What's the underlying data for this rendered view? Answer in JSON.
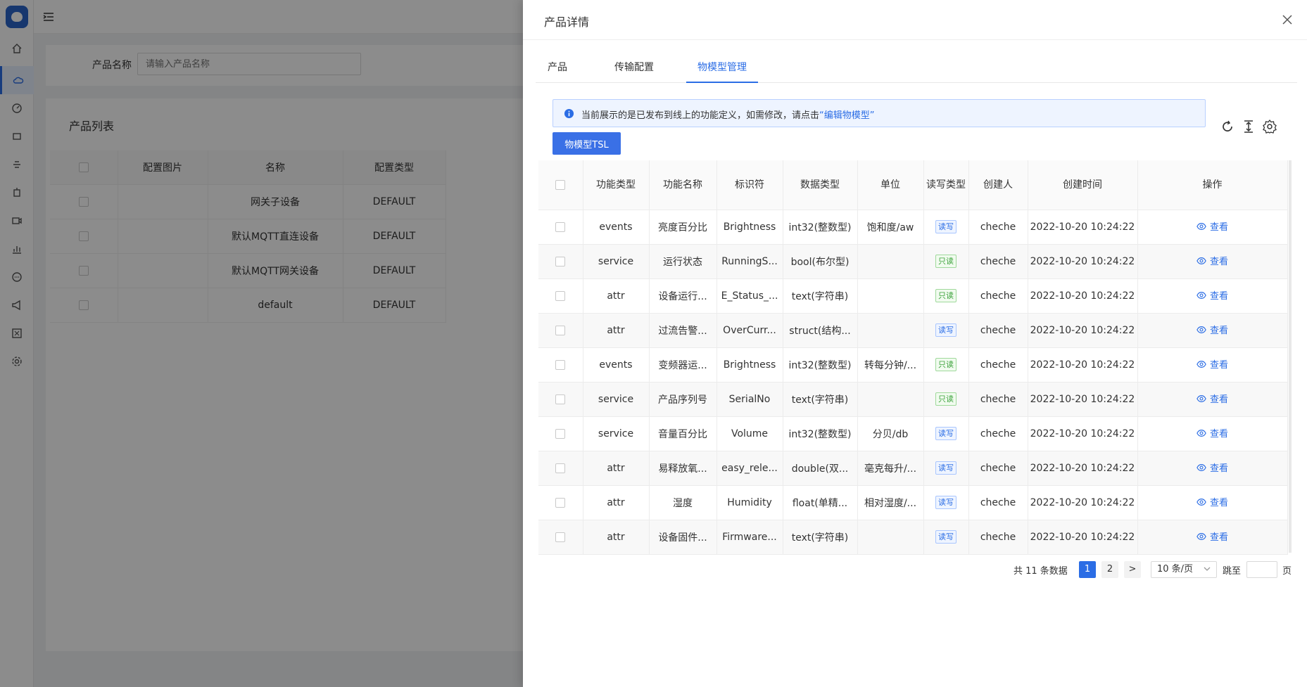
{
  "sidebar": {
    "icons": [
      "home-icon",
      "cloud-icon",
      "dashboard-icon",
      "frame-icon",
      "strike-icon",
      "device-icon",
      "video-icon",
      "chart-icon",
      "chat-icon",
      "megaphone-icon",
      "grid-icon",
      "gear-icon"
    ]
  },
  "search": {
    "label": "产品名称",
    "placeholder": "请输入产品名称"
  },
  "product_list": {
    "title": "产品列表",
    "columns": [
      "",
      "配置图片",
      "名称",
      "配置类型"
    ],
    "rows": [
      {
        "name": "网关子设备",
        "type": "DEFAULT"
      },
      {
        "name": "默认MQTT直连设备",
        "type": "DEFAULT"
      },
      {
        "name": "默认MQTT网关设备",
        "type": "DEFAULT"
      },
      {
        "name": "default",
        "type": "DEFAULT"
      }
    ]
  },
  "drawer": {
    "title": "产品详情",
    "tabs": [
      {
        "label": "产品",
        "active": false
      },
      {
        "label": "传输配置",
        "active": false
      },
      {
        "label": "物模型管理",
        "active": true
      }
    ],
    "alert": {
      "text": "当前展示的是已发布到线上的功能定义，如需修改，请点击",
      "link": "“编辑物模型”"
    },
    "tsl_button": "物模型TSL",
    "table": {
      "columns": [
        "",
        "功能类型",
        "功能名称",
        "标识符",
        "数据类型",
        "单位",
        "读写类型",
        "创建人",
        "创建时间",
        "操作"
      ],
      "rows": [
        {
          "kind": "events",
          "name": "亮度百分比",
          "id": "Brightness",
          "dtype": "int32(整数型)",
          "unit": "饱和度/aw",
          "rw": "读写",
          "creator": "cheche",
          "time": "2022-10-20 10:24:22",
          "op": "查看"
        },
        {
          "kind": "service",
          "name": "运行状态",
          "id": "RunningS...",
          "dtype": "bool(布尔型)",
          "unit": "",
          "rw": "只读",
          "creator": "cheche",
          "time": "2022-10-20 10:24:22",
          "op": "查看"
        },
        {
          "kind": "attr",
          "name": "设备运行...",
          "id": "E_Status_...",
          "dtype": "text(字符串)",
          "unit": "",
          "rw": "只读",
          "creator": "cheche",
          "time": "2022-10-20 10:24:22",
          "op": "查看"
        },
        {
          "kind": "attr",
          "name": "过流告警...",
          "id": "OverCurr...",
          "dtype": "struct(结构...",
          "unit": "",
          "rw": "读写",
          "creator": "cheche",
          "time": "2022-10-20 10:24:22",
          "op": "查看"
        },
        {
          "kind": "events",
          "name": "变频器运...",
          "id": "Brightness",
          "dtype": "int32(整数型)",
          "unit": "转每分钟/...",
          "rw": "只读",
          "creator": "cheche",
          "time": "2022-10-20 10:24:22",
          "op": "查看"
        },
        {
          "kind": "service",
          "name": "产品序列号",
          "id": "SerialNo",
          "dtype": "text(字符串)",
          "unit": "",
          "rw": "只读",
          "creator": "cheche",
          "time": "2022-10-20 10:24:22",
          "op": "查看"
        },
        {
          "kind": "service",
          "name": "音量百分比",
          "id": "Volume",
          "dtype": "int32(整数型)",
          "unit": "分贝/db",
          "rw": "读写",
          "creator": "cheche",
          "time": "2022-10-20 10:24:22",
          "op": "查看"
        },
        {
          "kind": "attr",
          "name": "易释放氧...",
          "id": "easy_rele...",
          "dtype": "double(双...",
          "unit": "毫克每升/...",
          "rw": "读写",
          "creator": "cheche",
          "time": "2022-10-20 10:24:22",
          "op": "查看"
        },
        {
          "kind": "attr",
          "name": "湿度",
          "id": "Humidity",
          "dtype": "float(单精...",
          "unit": "相对湿度/...",
          "rw": "读写",
          "creator": "cheche",
          "time": "2022-10-20 10:24:22",
          "op": "查看"
        },
        {
          "kind": "attr",
          "name": "设备固件...",
          "id": "Firmware...",
          "dtype": "text(字符串)",
          "unit": "",
          "rw": "读写",
          "creator": "cheche",
          "time": "2022-10-20 10:24:22",
          "op": "查看"
        }
      ]
    },
    "pagination": {
      "total": "共 11 条数据",
      "pages": [
        "1",
        "2"
      ],
      "current": "1",
      "next": ">",
      "page_size": "10 条/页",
      "jump_label": "跳至",
      "page_suffix": "页"
    }
  },
  "colors": {
    "primary": "#2b6de5",
    "tag_rw": "#2b6de5",
    "tag_ro": "#3da33d"
  }
}
